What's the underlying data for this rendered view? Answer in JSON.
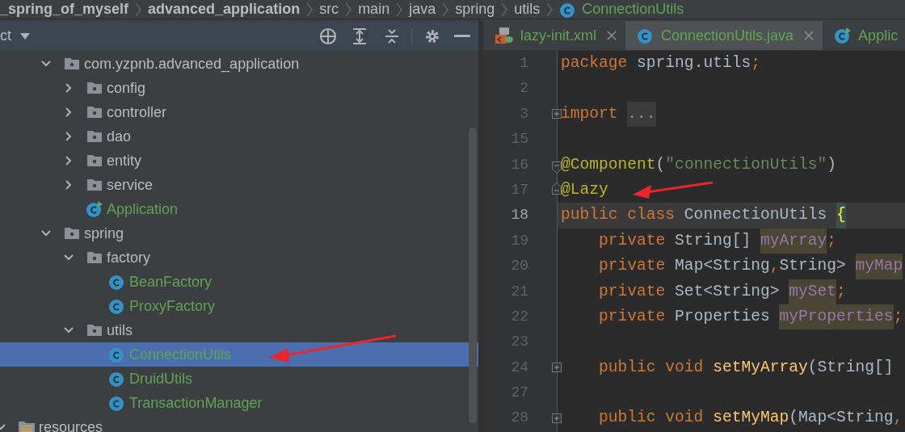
{
  "breadcrumb": [
    {
      "label": "_spring_of_myself",
      "bold": true,
      "kind": "text"
    },
    {
      "label": "advanced_application",
      "bold": true,
      "kind": "text"
    },
    {
      "label": "src",
      "bold": false,
      "kind": "text"
    },
    {
      "label": "main",
      "bold": false,
      "kind": "text"
    },
    {
      "label": "java",
      "bold": false,
      "kind": "text"
    },
    {
      "label": "spring",
      "bold": false,
      "kind": "text"
    },
    {
      "label": "utils",
      "bold": false,
      "kind": "text"
    },
    {
      "label": "ConnectionUtils",
      "bold": false,
      "kind": "class"
    }
  ],
  "project_panel": {
    "title": "ct",
    "tree": [
      {
        "label": "com.yzpnb.advanced_application",
        "kind": "package",
        "expanded": true,
        "selected": false,
        "children": [
          {
            "label": "config",
            "kind": "package",
            "expanded": false,
            "selected": false
          },
          {
            "label": "controller",
            "kind": "package",
            "expanded": false,
            "selected": false
          },
          {
            "label": "dao",
            "kind": "package",
            "expanded": false,
            "selected": false
          },
          {
            "label": "entity",
            "kind": "package",
            "expanded": false,
            "selected": false
          },
          {
            "label": "service",
            "kind": "package",
            "expanded": false,
            "selected": false
          },
          {
            "label": "Application",
            "kind": "main-class",
            "selected": false
          }
        ]
      },
      {
        "label": "spring",
        "kind": "package",
        "expanded": true,
        "selected": false,
        "children": [
          {
            "label": "factory",
            "kind": "package",
            "expanded": true,
            "selected": false,
            "children": [
              {
                "label": "BeanFactory",
                "kind": "class",
                "selected": false
              },
              {
                "label": "ProxyFactory",
                "kind": "class",
                "selected": false
              }
            ]
          },
          {
            "label": "utils",
            "kind": "package",
            "expanded": true,
            "selected": false,
            "children": [
              {
                "label": "ConnectionUtils",
                "kind": "class",
                "selected": true
              },
              {
                "label": "DruidUtils",
                "kind": "class",
                "selected": false
              },
              {
                "label": "TransactionManager",
                "kind": "class",
                "selected": false
              }
            ]
          }
        ]
      }
    ],
    "tree_below": [
      {
        "label": "resources",
        "kind": "resources-folder",
        "expanded": true,
        "selected": false
      }
    ]
  },
  "tabs": [
    {
      "label": "lazy-init.xml",
      "kind": "xml",
      "selected": false,
      "closable": true
    },
    {
      "label": "ConnectionUtils.java",
      "kind": "class",
      "selected": true,
      "closable": true
    },
    {
      "label": "Applic",
      "kind": "main-class",
      "selected": false,
      "closable": false
    }
  ],
  "editor": {
    "lines": [
      {
        "number": "1",
        "tokens": [
          {
            "kind": "keyword",
            "text": "package "
          },
          {
            "kind": "plain",
            "text": "spring.utils"
          },
          {
            "kind": "keyword",
            "text": ";"
          }
        ]
      },
      {
        "number": "2"
      },
      {
        "number": "3",
        "folded": true,
        "tokens": [
          {
            "kind": "keyword",
            "text": "import "
          },
          {
            "kind": "folded",
            "text": "..."
          }
        ]
      },
      {
        "number": "15"
      },
      {
        "number": "16",
        "folded": false,
        "fold_end": false,
        "tokens": [
          {
            "kind": "annotation",
            "text": "@Component"
          },
          {
            "kind": "plain",
            "text": "("
          },
          {
            "kind": "string",
            "text": "\"connectionUtils\""
          },
          {
            "kind": "plain",
            "text": ")"
          }
        ]
      },
      {
        "number": "17",
        "folded": false,
        "fold_end": true,
        "tokens": [
          {
            "kind": "annotation",
            "text": "@Lazy"
          }
        ]
      },
      {
        "number": "18",
        "current": true,
        "tokens": [
          {
            "kind": "keyword",
            "text": "public class "
          },
          {
            "kind": "plain",
            "text": "ConnectionUtils "
          },
          {
            "kind": "brace-match",
            "text": "{"
          }
        ]
      },
      {
        "number": "19",
        "tokens": [
          {
            "kind": "keyword",
            "text": "    private "
          },
          {
            "kind": "plain",
            "text": "String[] "
          },
          {
            "kind": "field",
            "text": "myArray"
          },
          {
            "kind": "keyword",
            "text": ";"
          }
        ]
      },
      {
        "number": "20",
        "tokens": [
          {
            "kind": "keyword",
            "text": "    private "
          },
          {
            "kind": "plain",
            "text": "Map<String"
          },
          {
            "kind": "keyword",
            "text": ","
          },
          {
            "kind": "plain",
            "text": "String> "
          },
          {
            "kind": "field",
            "text": "myMap"
          }
        ]
      },
      {
        "number": "21",
        "tokens": [
          {
            "kind": "keyword",
            "text": "    private "
          },
          {
            "kind": "plain",
            "text": "Set<String> "
          },
          {
            "kind": "field",
            "text": "mySet"
          },
          {
            "kind": "keyword",
            "text": ";"
          }
        ]
      },
      {
        "number": "22",
        "tokens": [
          {
            "kind": "keyword",
            "text": "    private "
          },
          {
            "kind": "plain",
            "text": "Properties "
          },
          {
            "kind": "field",
            "text": "myProperties"
          },
          {
            "kind": "keyword",
            "text": ";"
          }
        ]
      },
      {
        "number": "23"
      },
      {
        "number": "24",
        "folded": true,
        "tokens": [
          {
            "kind": "keyword",
            "text": "    public void "
          },
          {
            "kind": "method",
            "text": "setMyArray"
          },
          {
            "kind": "plain",
            "text": "(String[]"
          }
        ]
      },
      {
        "number": "27"
      },
      {
        "number": "28",
        "folded": true,
        "tokens": [
          {
            "kind": "keyword",
            "text": "    public void "
          },
          {
            "kind": "method",
            "text": "setMyMap"
          },
          {
            "kind": "plain",
            "text": "(Map<String"
          },
          {
            "kind": "keyword",
            "text": ","
          }
        ]
      }
    ]
  }
}
